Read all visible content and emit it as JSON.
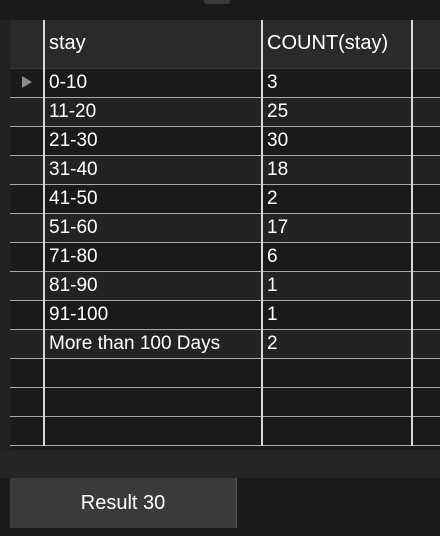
{
  "table": {
    "columns": [
      "stay",
      "COUNT(stay)"
    ],
    "rows": [
      {
        "stay": "0-10",
        "count": "3"
      },
      {
        "stay": "11-20",
        "count": "25"
      },
      {
        "stay": "21-30",
        "count": "30"
      },
      {
        "stay": "31-40",
        "count": "18"
      },
      {
        "stay": "41-50",
        "count": "2"
      },
      {
        "stay": "51-60",
        "count": "17"
      },
      {
        "stay": "71-80",
        "count": "6"
      },
      {
        "stay": "81-90",
        "count": "1"
      },
      {
        "stay": "91-100",
        "count": "1"
      },
      {
        "stay": "More than 100 Days",
        "count": "2"
      }
    ],
    "current_row_indicator_icon": "triangle-right-icon"
  },
  "tabs": [
    {
      "label": "Result 30"
    }
  ]
}
